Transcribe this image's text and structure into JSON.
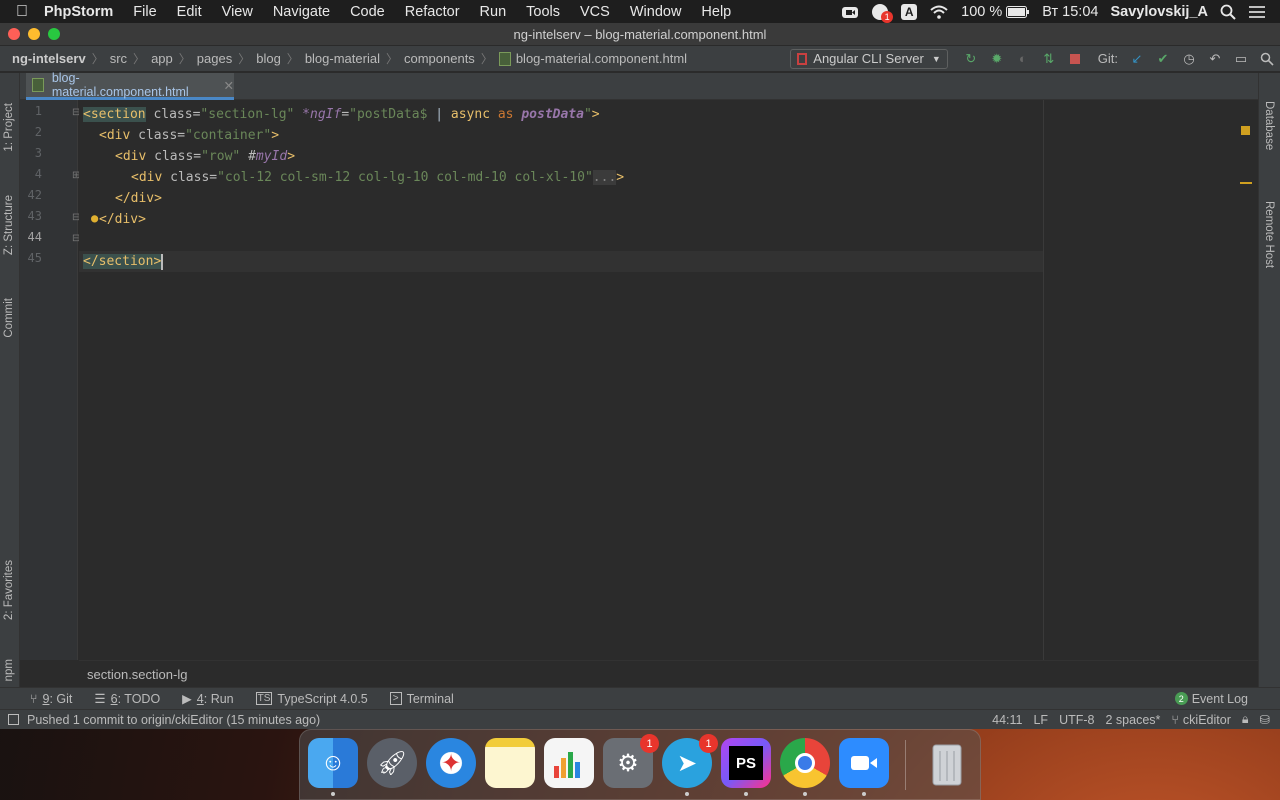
{
  "menubar": {
    "app_name": "PhpStorm",
    "items": [
      "File",
      "Edit",
      "View",
      "Navigate",
      "Code",
      "Refactor",
      "Run",
      "Tools",
      "VCS",
      "Window",
      "Help"
    ],
    "battery": "100 %",
    "clock": "Вт 15:04",
    "user": "Savylovskij_A",
    "badge_count": "1"
  },
  "window": {
    "title": "ng-intelserv – blog-material.component.html"
  },
  "navbar": {
    "crumbs": [
      "ng-intelserv",
      "src",
      "app",
      "pages",
      "blog",
      "blog-material",
      "components",
      "blog-material.component.html"
    ],
    "run_config": "Angular CLI Server",
    "git_label": "Git:"
  },
  "tabs": [
    {
      "label": "blog-material.component.html"
    }
  ],
  "left_tools": [
    "1: Project",
    "Z: Structure",
    "Commit",
    "2: Favorites",
    "npm"
  ],
  "right_tools": [
    "Database",
    "Remote Host"
  ],
  "editor": {
    "line_numbers": [
      "1",
      "2",
      "3",
      "4",
      "42",
      "43",
      "44",
      "45"
    ],
    "lines": {
      "l1": {
        "open": "<section",
        "a1": " class=",
        "s1": "\"section-lg\"",
        "a2": " ",
        "i1": "*ngIf",
        "a3": "=",
        "s2": "\"postData$ ",
        "p": "| ",
        "k1": "async",
        "k2": " as ",
        "i2": "postData",
        "s3": "\"",
        "close": ">"
      },
      "l2": {
        "open": "<div",
        "a1": " class=",
        "s1": "\"container\"",
        "close": ">"
      },
      "l3": {
        "open": "<div",
        "a1": " class=",
        "s1": "\"row\"",
        "a2": " #",
        "i1": "myId",
        "close": ">"
      },
      "l4": {
        "open": "<div",
        "a1": " class=",
        "s1": "\"col-12 col-sm-12 col-lg-10 col-md-10 col-xl-10\"",
        "fold": "...",
        "close": ">"
      },
      "l42": {
        "text": "</div>"
      },
      "l43": {
        "text": "</div>"
      },
      "l44": {
        "text": "</section>"
      }
    }
  },
  "breadcrumb_bar": {
    "text": "section.section-lg"
  },
  "tool_windows": [
    {
      "num": "9",
      "label": ": Git"
    },
    {
      "num": "6",
      "label": ": TODO"
    },
    {
      "num": "4",
      "label": ": Run"
    },
    {
      "num": "",
      "label": "TypeScript 4.0.5"
    },
    {
      "num": "",
      "label": "Terminal"
    }
  ],
  "event_log": {
    "count": "2",
    "label": "Event Log"
  },
  "status": {
    "message": "Pushed 1 commit to origin/ckiEditor (15 minutes ago)",
    "position": "44:11",
    "line_sep": "LF",
    "encoding": "UTF-8",
    "indent": "2 spaces*",
    "branch": "ckiEditor"
  },
  "dock": {
    "apps": [
      "finder-icon",
      "launchpad-icon",
      "safari-icon",
      "notes-icon",
      "numbers-icon",
      "system-preferences-icon",
      "telegram-icon",
      "phpstorm-icon",
      "chrome-icon",
      "zoom-icon",
      "trash-icon"
    ],
    "phpstorm_label": "PS",
    "badge_prefs": "1",
    "badge_telegram": "1"
  },
  "colors": {
    "accent": "#4a88c7",
    "tag": "#e8bf6a",
    "string": "#6a8759",
    "keyword": "#cc7832",
    "italic": "#9876aa"
  }
}
